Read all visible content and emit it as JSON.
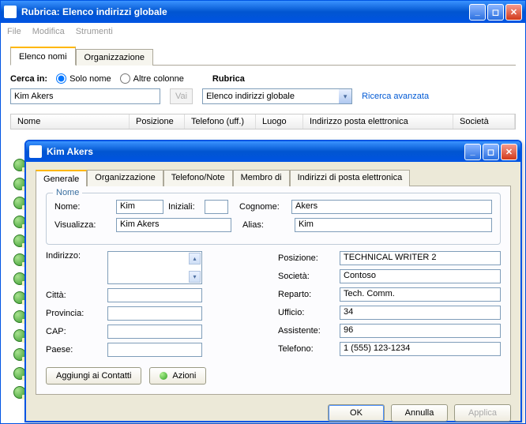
{
  "mainWindow": {
    "title": "Rubrica: Elenco indirizzi globale",
    "menu": {
      "file": "File",
      "modifica": "Modifica",
      "strumenti": "Strumenti"
    },
    "tabs": {
      "elencoNomi": "Elenco nomi",
      "organizzazione": "Organizzazione"
    },
    "search": {
      "label": "Cerca in:",
      "optSoloNome": "Solo nome",
      "optAltreColonne": "Altre colonne",
      "rubricaLabel": "Rubrica",
      "inputValue": "Kim Akers",
      "vaiBtn": "Vai",
      "comboValue": "Elenco indirizzi globale",
      "advancedLink": "Ricerca avanzata"
    },
    "columns": {
      "nome": "Nome",
      "posizione": "Posizione",
      "telefono": "Telefono (uff.)",
      "luogo": "Luogo",
      "email": "Indirizzo posta elettronica",
      "societa": "Società"
    }
  },
  "detailWindow": {
    "title": "Kim Akers",
    "tabs": {
      "generale": "Generale",
      "organizzazione": "Organizzazione",
      "telefonoNote": "Telefono/Note",
      "membroDi": "Membro di",
      "indirizzi": "Indirizzi di posta elettronica"
    },
    "groupNome": "Nome",
    "labels": {
      "nome": "Nome:",
      "iniziali": "Iniziali:",
      "cognome": "Cognome:",
      "visualizza": "Visualizza:",
      "alias": "Alias:",
      "indirizzo": "Indirizzo:",
      "citta": "Città:",
      "provincia": "Provincia:",
      "cap": "CAP:",
      "paese": "Paese:",
      "posizione": "Posizione:",
      "societa": "Società:",
      "reparto": "Reparto:",
      "ufficio": "Ufficio:",
      "assistente": "Assistente:",
      "telefono": "Telefono:"
    },
    "values": {
      "nome": "Kim",
      "iniziali": "",
      "cognome": "Akers",
      "visualizza": "Kim Akers",
      "alias": "Kim",
      "indirizzo": "",
      "citta": "",
      "provincia": "",
      "cap": "",
      "paese": "",
      "posizione": "TECHNICAL WRITER 2",
      "societa": "Contoso",
      "reparto": "Tech. Comm.",
      "ufficio": "34",
      "assistente": "96",
      "telefono": "1 (555) 123-1234"
    },
    "buttons": {
      "aggiungi": "Aggiungi ai Contatti",
      "azioni": "Azioni",
      "ok": "OK",
      "annulla": "Annulla",
      "applica": "Applica"
    }
  }
}
